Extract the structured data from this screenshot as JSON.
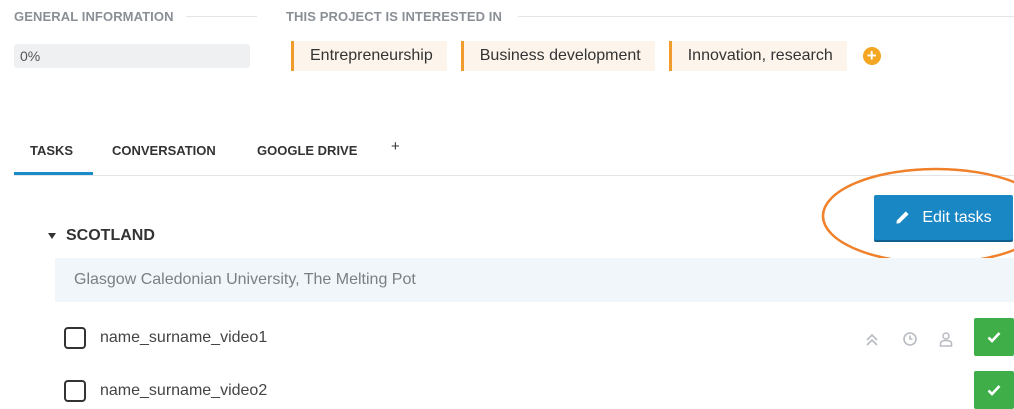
{
  "general_info": {
    "heading": "GENERAL INFORMATION",
    "progress_value": 0,
    "progress_label": "0%"
  },
  "interests": {
    "heading": "THIS PROJECT IS INTERESTED IN",
    "items": [
      "Entrepreneurship",
      "Business development",
      "Innovation, research"
    ],
    "add_icon": "plus-circle-icon",
    "accent_color": "#f19b2c"
  },
  "tabs": {
    "items": [
      "TASKS",
      "CONVERSATION",
      "GOOGLE DRIVE"
    ],
    "active": "TASKS",
    "add_label": "+",
    "active_color": "#1a8bc9"
  },
  "toolbar": {
    "edit_label": "Edit tasks",
    "edit_icon": "pencil-icon",
    "button_color": "#1a87c5"
  },
  "region": {
    "title": "SCOTLAND",
    "location": "Glasgow Caledonian University, The Melting Pot"
  },
  "tasks": [
    {
      "label": "name_surname_video1",
      "icons": [
        "priority-up-icon",
        "clock-icon",
        "user-icon"
      ]
    },
    {
      "label": "name_surname_video2",
      "icons": []
    }
  ],
  "colors": {
    "complete_button": "#3fae49",
    "annotation_ellipse": "#f0802a"
  }
}
